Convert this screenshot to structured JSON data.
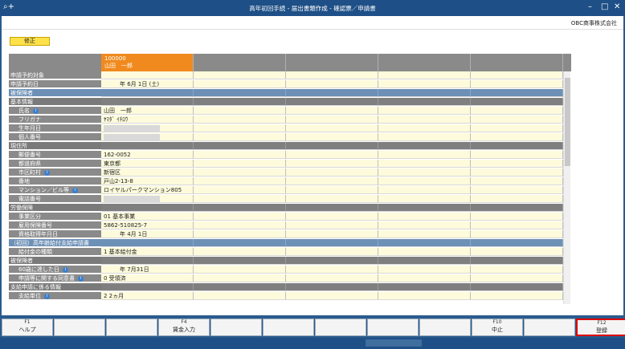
{
  "window": {
    "title": "高年初回手続 - 届出書類作成 - 確認票／申請書"
  },
  "company": "OBC商事株式会社",
  "mode_label": "修正",
  "employee": {
    "code": "100000",
    "name": "山田　一郎"
  },
  "rows": [
    {
      "label": "申請予約対象",
      "style": "l1",
      "c1": ""
    },
    {
      "label": "申請予約日",
      "style": "l1",
      "c1": "年  6月  1日 (土)"
    },
    {
      "label": "被保険者",
      "style": "blue",
      "c1": ""
    },
    {
      "label": "基本情報",
      "style": "sec",
      "c1": ""
    },
    {
      "label": "氏名",
      "style": "l2",
      "info": true,
      "c1": "山田　一郎"
    },
    {
      "label": "フリガナ",
      "style": "l2",
      "c1": "ﾔﾏﾀﾞ  ｲﾁﾛｳ"
    },
    {
      "label": "生年月日",
      "style": "l2",
      "c1": ""
    },
    {
      "label": "個人番号",
      "style": "l2",
      "c1": ""
    },
    {
      "label": "現住所",
      "style": "sec",
      "c1": ""
    },
    {
      "label": "郵便番号",
      "style": "l2",
      "c1": "162-0052"
    },
    {
      "label": "都道府県",
      "style": "l2",
      "c1": "東京都"
    },
    {
      "label": "市区町村",
      "style": "l2",
      "info": true,
      "c1": "新宿区"
    },
    {
      "label": "番地",
      "style": "l2",
      "c1": "戸山2-13-8"
    },
    {
      "label": "マンション／ビル等",
      "style": "l2",
      "info": true,
      "c1": "ロイヤルパークマンション805"
    },
    {
      "label": "電話番号",
      "style": "l2",
      "c1": ""
    },
    {
      "label": "労働保険",
      "style": "sec",
      "c1": ""
    },
    {
      "label": "事業区分",
      "style": "l2",
      "c1": "01    基本事業"
    },
    {
      "label": "雇用保険番号",
      "style": "l2",
      "c1": "5862-510825-7"
    },
    {
      "label": "資格取得年月日",
      "style": "l2",
      "c1": "年  4月  1日"
    },
    {
      "label": "（初回）高年齢給付支給申請書",
      "style": "blue",
      "c1": ""
    },
    {
      "label": "給付金の種類",
      "style": "l2",
      "c1": "1    基本給付金"
    },
    {
      "label": "被保険者",
      "style": "sec",
      "c1": ""
    },
    {
      "label": "60歳に達した日",
      "style": "l2",
      "info": true,
      "c1": "年  7月31日"
    },
    {
      "label": "申請等に関する同意書",
      "style": "l2",
      "info": true,
      "c1": "0    受領済"
    },
    {
      "label": "支給申請に係る情報",
      "style": "sec",
      "c1": ""
    },
    {
      "label": "支給単位",
      "style": "l2",
      "info": true,
      "c1": "2    2ヵ月"
    }
  ],
  "fkeys": [
    {
      "key": "F1",
      "label": "ヘルプ"
    },
    {
      "key": "",
      "label": ""
    },
    {
      "key": "",
      "label": ""
    },
    {
      "key": "F4",
      "label": "賃金入力"
    },
    {
      "key": "",
      "label": ""
    },
    {
      "key": "",
      "label": ""
    },
    {
      "key": "",
      "label": ""
    },
    {
      "key": "",
      "label": ""
    },
    {
      "key": "",
      "label": ""
    },
    {
      "key": "F10",
      "label": "中止"
    },
    {
      "key": "",
      "label": ""
    },
    {
      "key": "F12",
      "label": "登録"
    }
  ]
}
